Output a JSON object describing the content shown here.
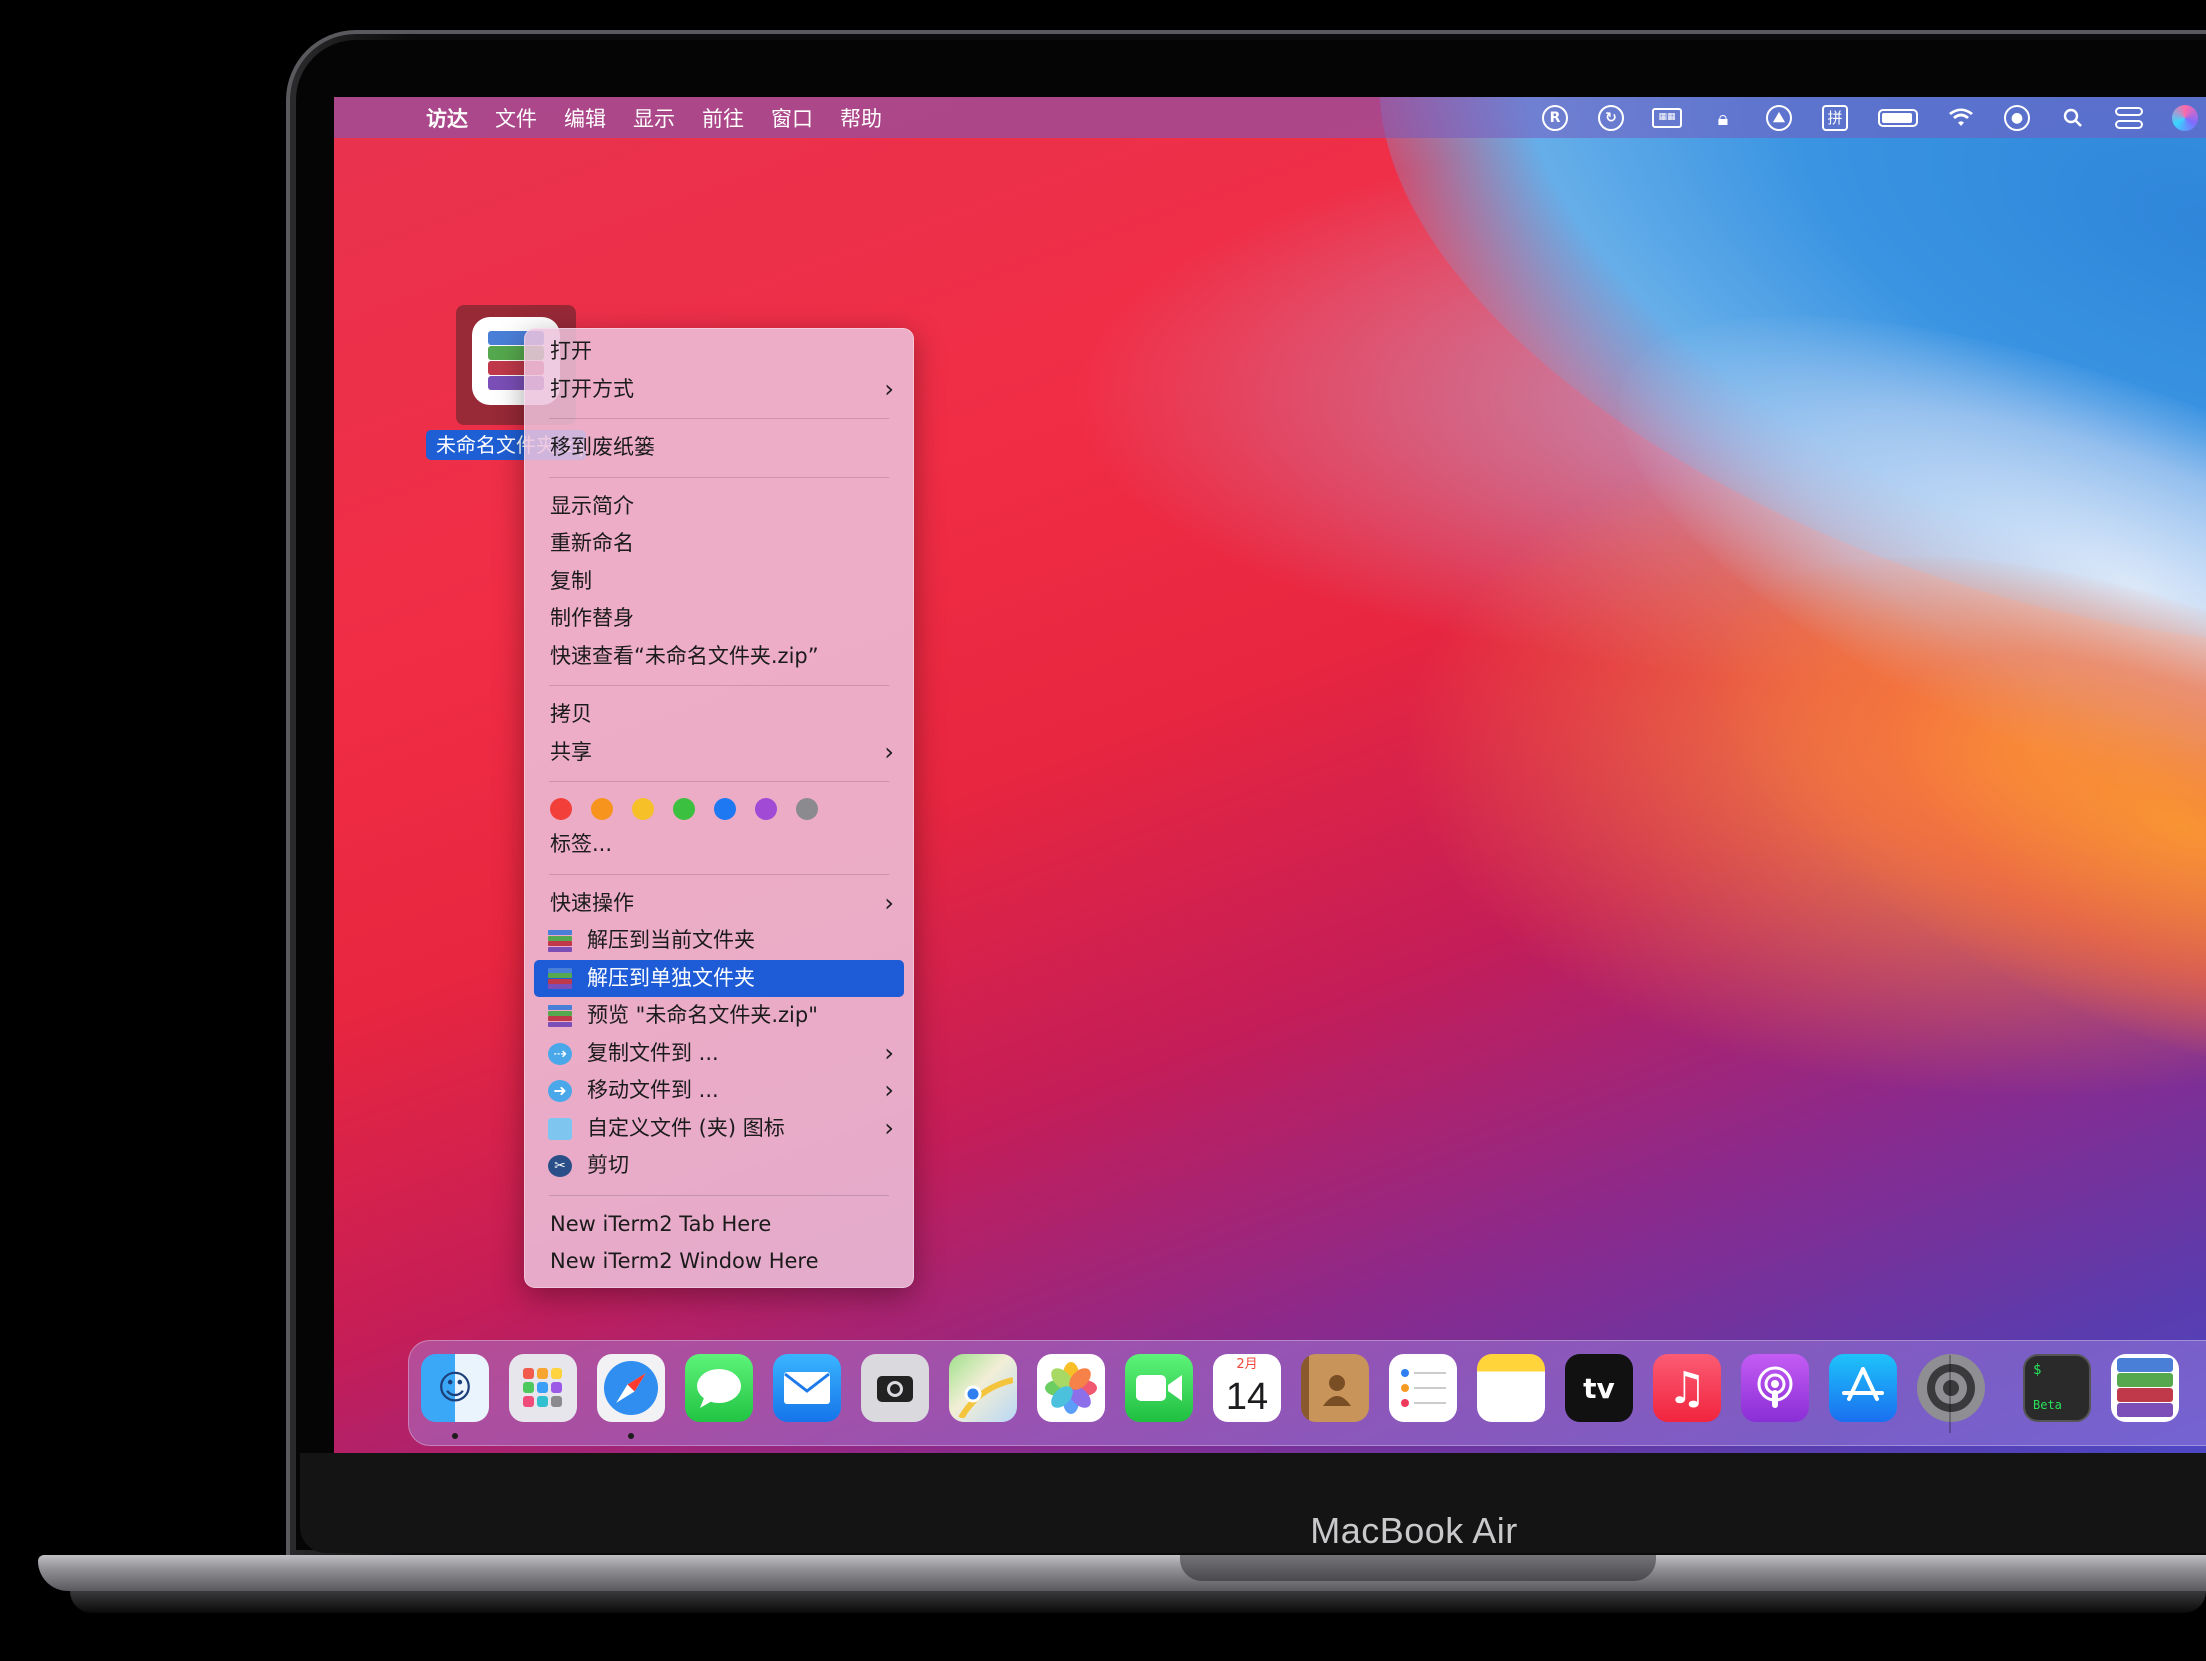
{
  "device": {
    "brand": "MacBook Air"
  },
  "menubar": {
    "apple_icon": "apple-logo-icon",
    "app_name": "访达",
    "items": [
      "文件",
      "编辑",
      "显示",
      "前往",
      "窗口",
      "帮助"
    ],
    "status_icons": [
      "r-circle-icon",
      "sync-icon",
      "keyboard-icon",
      "lock-icon",
      "picture-icon",
      "pinyin-icon",
      "battery-icon",
      "wifi-icon",
      "user-icon",
      "search-icon",
      "control-center-icon",
      "siri-icon"
    ],
    "pinyin_label": "拼",
    "r_label": "R"
  },
  "desktop": {
    "file_name": "未命名文件夹.zip",
    "file_label_visible": "未命名文件"
  },
  "context_menu": {
    "open": "打开",
    "open_with": "打开方式",
    "trash": "移到废纸篓",
    "get_info": "显示简介",
    "rename": "重新命名",
    "duplicate": "复制",
    "make_alias": "制作替身",
    "quick_look": "快速查看“未命名文件夹.zip”",
    "copy": "拷贝",
    "share": "共享",
    "tag_colors": [
      "#f23f3a",
      "#f7941e",
      "#f6c028",
      "#3cc03f",
      "#1d78f2",
      "#a04ad6",
      "#8a8a8f"
    ],
    "tags": "标签...",
    "quick_actions": "快速操作",
    "extract_current": "解压到当前文件夹",
    "extract_separate": "解压到单独文件夹",
    "preview": "预览 \"未命名文件夹.zip\"",
    "copy_file_to": "复制文件到 ...",
    "move_file_to": "移动文件到 ...",
    "custom_icon": "自定义文件 (夹) 图标",
    "cut": "剪切",
    "iterm_tab": "New iTerm2 Tab Here",
    "iterm_window": "New iTerm2 Window Here",
    "highlighted": "extract_separate"
  },
  "dock": {
    "apps": [
      "finder",
      "launchpad",
      "safari",
      "messages",
      "mail",
      "screenshot",
      "maps",
      "photos",
      "facetime",
      "calendar",
      "contacts",
      "reminders",
      "notes",
      "apple-tv",
      "music",
      "podcasts",
      "app-store",
      "system-preferences",
      "terminal-beta",
      "archive-utility"
    ],
    "calendar_month": "2月",
    "calendar_day": "14",
    "tv_label": "tv",
    "terminal_label": "Beta",
    "terminal_prompt": "$"
  }
}
